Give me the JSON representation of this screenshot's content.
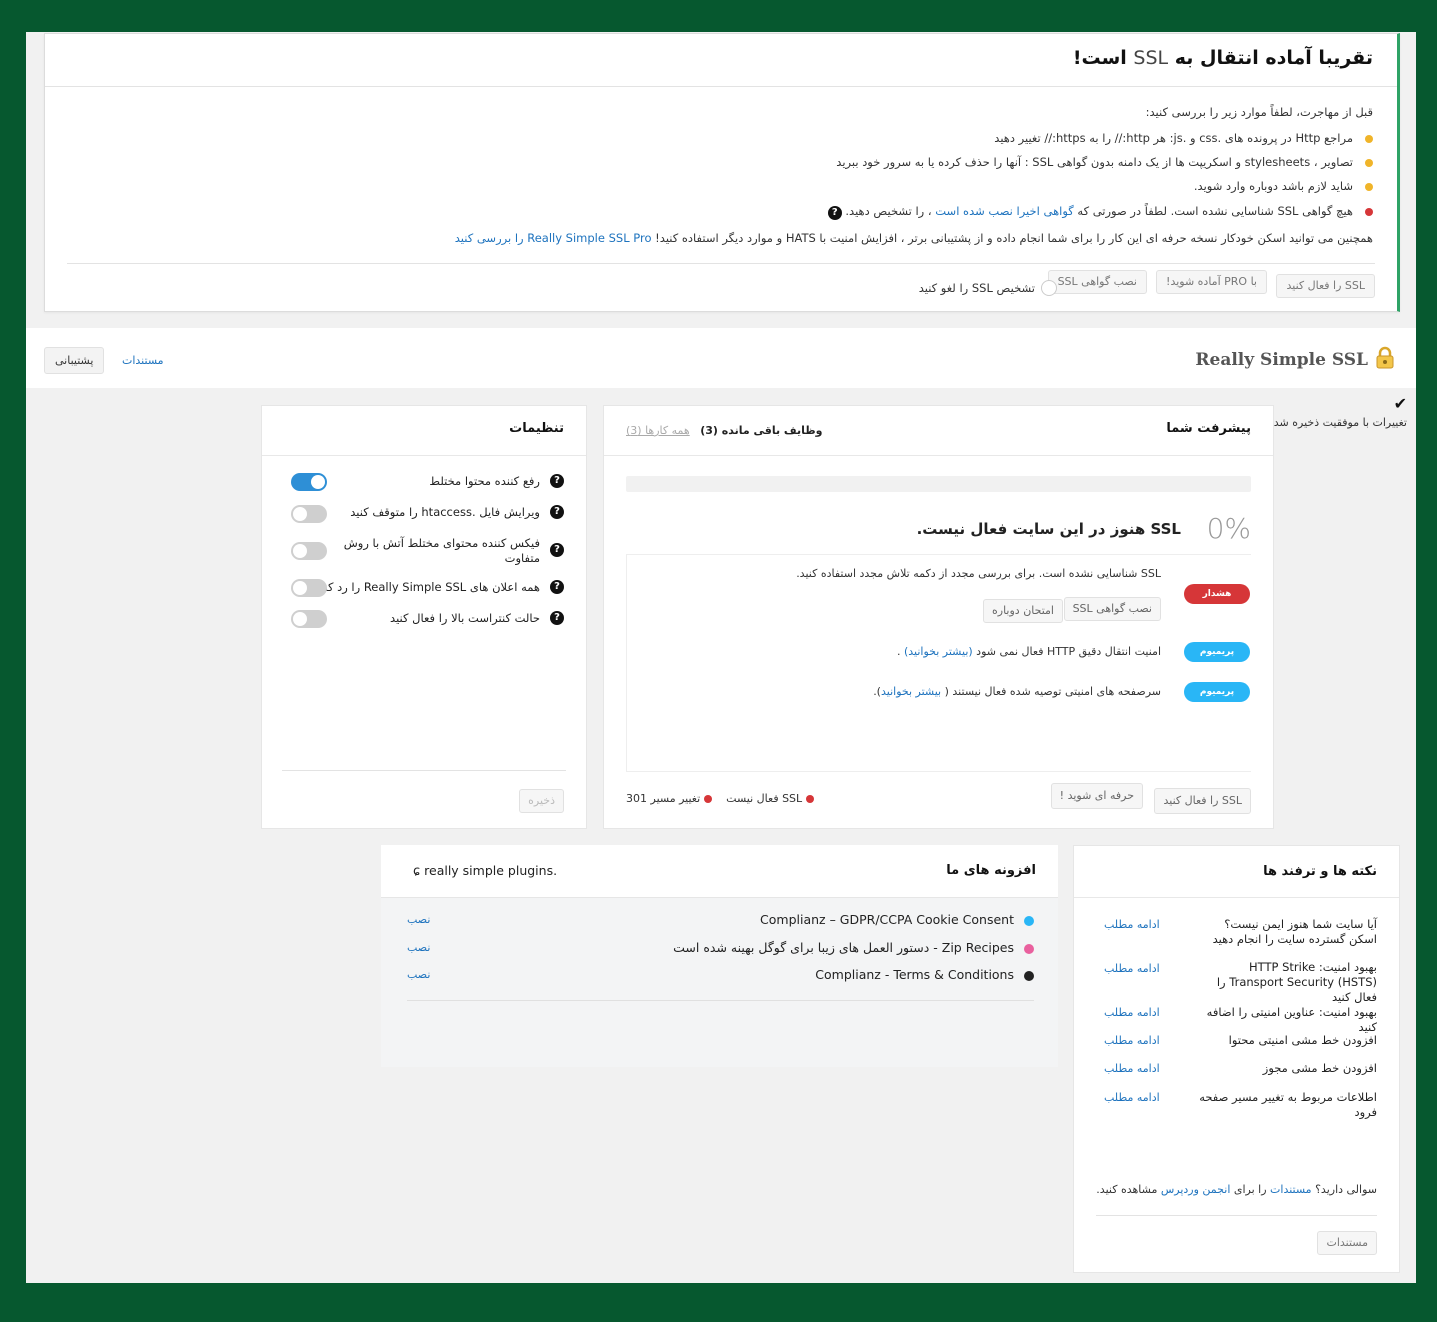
{
  "notice": {
    "title_prefix": "تقریبا آماده انتقال به",
    "title_ssl": "SSL",
    "title_suffix": "است!",
    "intro": "قبل از مهاجرت، لطفاً موارد زیر را بررسی کنید:",
    "items": [
      {
        "color": "#f0b429",
        "text": "مراجع Http در پرونده های .css و .js: هر http:// را به https:// تغییر دهید"
      },
      {
        "color": "#f0b429",
        "text": "تصاویر ، stylesheets و اسکریپت ها از یک دامنه بدون گواهی SSL : آنها را حذف کرده یا به سرور خود ببرید"
      },
      {
        "color": "#f0b429",
        "text": "شاید لازم باشد دوباره وارد شوید."
      },
      {
        "color": "#d63638",
        "text": "هیچ گواهی SSL شناسایی نشده است.  لطفاً در صورتی که",
        "link": "گواهی اخیرا نصب شده است",
        "after": "، را تشخیص دهید."
      }
    ],
    "pro_text": "همچنین می توانید اسکن خودکار نسخه حرفه ای این کار را برای شما انجام داده و از پشتیبانی برتر ، افزایش امنیت با HATS و موارد دیگر استفاده کنید!",
    "pro_link": "Really Simple SSL Pro را بررسی کنید",
    "buttons": {
      "activate": "SSL را فعال کنید",
      "pro": "با PRO آماده شوید!",
      "install": "نصب گواهی SSL",
      "dismiss": "تشخیص SSL را لغو کنید"
    }
  },
  "header": {
    "logo_text": "Really Simple SSL",
    "docs": "مستندات",
    "support": "پشتیبانی"
  },
  "saved_notice": "تغییرات با موفقیت ذخیره شد",
  "progress": {
    "title": "پیشرفت شما",
    "tab_all": "همه کارها (3)",
    "tab_remaining": "وظایف باقی مانده (3)",
    "percent": "0%",
    "headline": "SSL هنوز در این سایت فعال نیست.",
    "tasks": [
      {
        "badge": "هشدار",
        "badge_color": "#d63638",
        "text": "SSL شناسایی نشده است. برای بررسی مجدد از دکمه تلاش مجدد استفاده کنید."
      },
      {
        "badge": "پریمیوم",
        "badge_color": "#29b6f6",
        "text": "امنیت انتقال دقیق HTTP فعال نمی شود",
        "link": "(بیشتر بخوانید)",
        "after": " ."
      },
      {
        "badge": "پریمیوم",
        "badge_color": "#29b6f6",
        "text": "سرصفحه های امنیتی توصیه شده فعال نیستند (",
        "link": "بیشتر بخوانید",
        "after": ")."
      }
    ],
    "task_buttons": {
      "install": "نصب گواهی SSL",
      "retry": "امتحان دوباره"
    },
    "footer_buttons": {
      "activate": "SSL را فعال کنید",
      "go_pro": "حرفه ای شوید !"
    },
    "status_redirect": "تغییر مسیر 301",
    "status_ssl": "SSL فعال نیست"
  },
  "settings": {
    "title": "تنظیمات",
    "items": [
      {
        "label": "رفع کننده محتوا مختلط",
        "on": true
      },
      {
        "label": "ویرایش فایل .htaccess را متوقف کنید",
        "on": false
      },
      {
        "label": "فیکس کننده محتوای مختلط آتش با روش متفاوت",
        "on": false
      },
      {
        "label": "همه اعلان های Really Simple SSL را رد کنید",
        "on": false
      },
      {
        "label": "حالت کنتراست بالا را فعال کنید",
        "on": false
      }
    ],
    "save": "ذخیره"
  },
  "tips": {
    "title": "نکته ها و ترفند ها",
    "read_more": "ادامه مطلب",
    "items": [
      "آیا سایت شما هنوز ایمن نیست؟ اسکن گسترده سایت را انجام دهید",
      "بهبود امنیت: HTTP Strike Transport Security (HSTS) را فعال کنید",
      "بهبود امنیت: عناوین امنیتی را اضافه کنید",
      "افزودن خط مشی امنیتی محتوا",
      "افزودن خط مشی مجوز",
      "اطلاعات مربوط به تغییر مسیر صفحه فرود"
    ],
    "question_prefix": "سوالی دارید؟",
    "question_docs": "مستندات",
    "question_mid": "را برای",
    "question_forum": "انجمن وردپرس",
    "question_suffix": "مشاهده کنید.",
    "docs_button": "مستندات"
  },
  "plugins": {
    "title": "افزونه های ما",
    "brand": "really simple plugins.",
    "install": "نصب",
    "items": [
      {
        "name": "Complianz – GDPR/CCPA Cookie Consent",
        "color": "#29b6f6"
      },
      {
        "name": "Zip Recipes - دستور العمل های زیبا برای گوگل بهینه شده است",
        "color": "#e9609e"
      },
      {
        "name": "Complianz - Terms & Conditions",
        "color": "#222222"
      }
    ]
  }
}
